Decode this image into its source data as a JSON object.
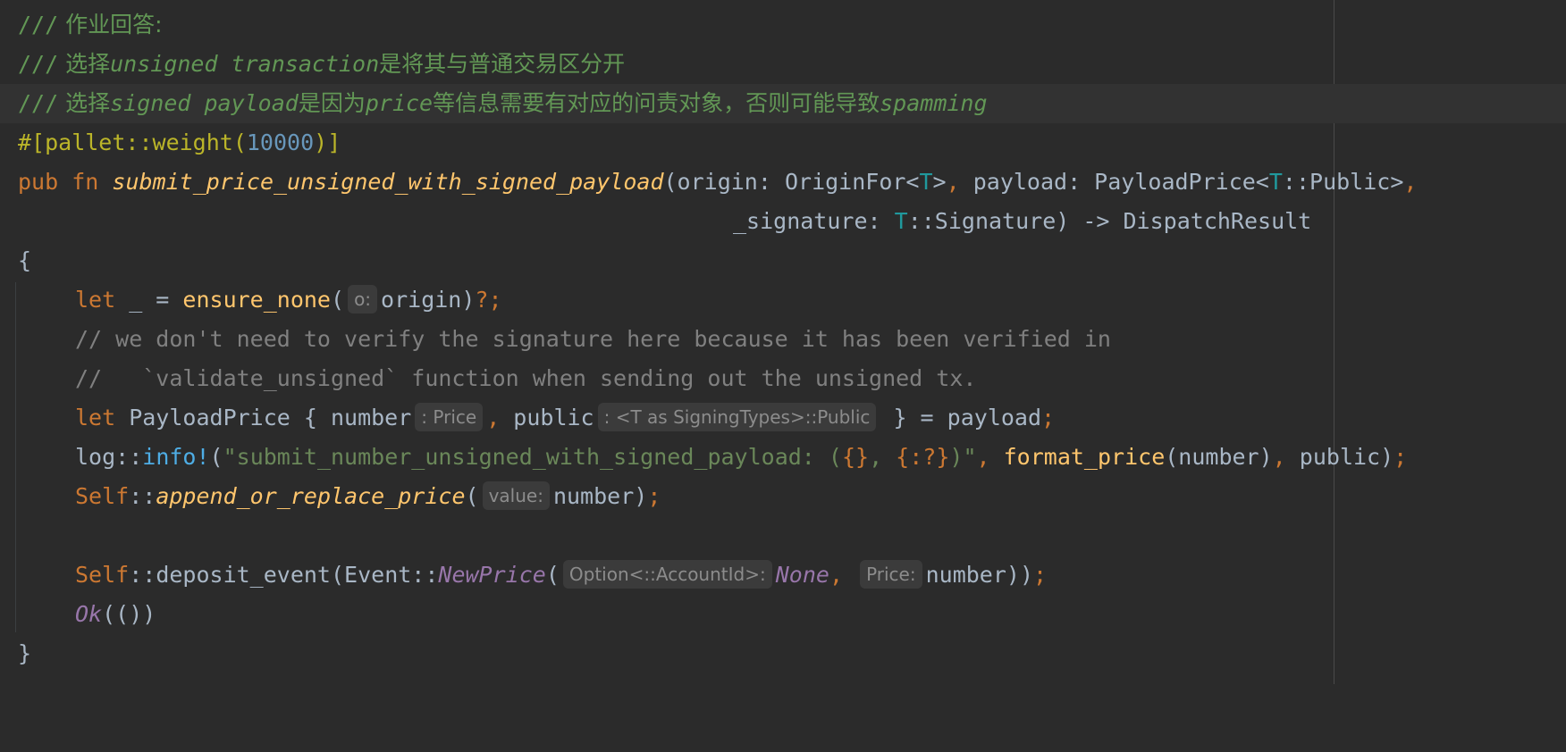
{
  "editor": {
    "lines": [
      {
        "doc_prefix": "///",
        "text": " 作业回答:"
      },
      {
        "doc_prefix": "///",
        "a": " 选择",
        "b": "unsigned transaction",
        "c": "是将其与普通交易区分开"
      },
      {
        "doc_prefix": "///",
        "a": " 选择",
        "b": "signed payload",
        "c": "是因为",
        "d": "price",
        "e": "等信息需要有对应的问责对象，否则可能导致",
        "f": "spamming"
      },
      {
        "attr_open": "#[pallet::weight(",
        "num": "10000",
        "attr_close": ")]"
      },
      {
        "kw_pub": "pub",
        "kw_fn": "fn",
        "fn_name": "submit_price_unsigned_with_signed_payload",
        "p1": "(origin: OriginFor<",
        "t1": "T",
        "p2": ">",
        "comma1": ",",
        "p3": " payload: PayloadPrice<",
        "t2": "T",
        "p4": "::Public>",
        "comma2": ","
      },
      {
        "p1": "_signature: ",
        "t1": "T",
        "p2": "::Signature) -> DispatchResult"
      },
      {
        "text": "{"
      },
      {
        "kw_let": "let",
        "p1": " _ = ",
        "fn": "ensure_none",
        "p2": "(",
        "hint": "o:",
        "p3": "origin)",
        "q": "?;"
      },
      {
        "comment": "// we don't need to verify the signature here because it has been verified in"
      },
      {
        "comment": "//   `validate_unsigned` function when sending out the unsigned tx."
      },
      {
        "kw_let": "let",
        "p1": " PayloadPrice { number",
        "hint1": ": Price",
        "comma": ",",
        "p2": " public",
        "hint2": ": <T as SigningTypes>::Public",
        "p3": " } = payload",
        "semi": ";"
      },
      {
        "p1": "log::",
        "macro": "info!",
        "p2": "(",
        "str1": "\"submit_number_unsigned_with_signed_payload: (",
        "fmt1": "{}",
        "str2": ", ",
        "fmt2": "{:?}",
        "str3": ")\"",
        "comma": ",",
        "fn": "format_price",
        "p3": "(number)",
        "comma2": ",",
        "p4": " public)",
        "semi": ";"
      },
      {
        "self": "Self",
        "p1": "::",
        "fn": "append_or_replace_price",
        "p2": "(",
        "hint": "value:",
        "p3": "number)",
        "semi": ";"
      },
      {
        "text": ""
      },
      {
        "self": "Self",
        "p1": "::deposit_event(Event::",
        "variant": "NewPrice",
        "p2": "(",
        "hint1": "Option<::AccountId>:",
        "none": "None",
        "comma": ",",
        "hint2": "Price:",
        "p3": "number))",
        "semi": ";"
      },
      {
        "ok": "Ok",
        "p1": "(())"
      },
      {
        "text": "}"
      }
    ]
  }
}
